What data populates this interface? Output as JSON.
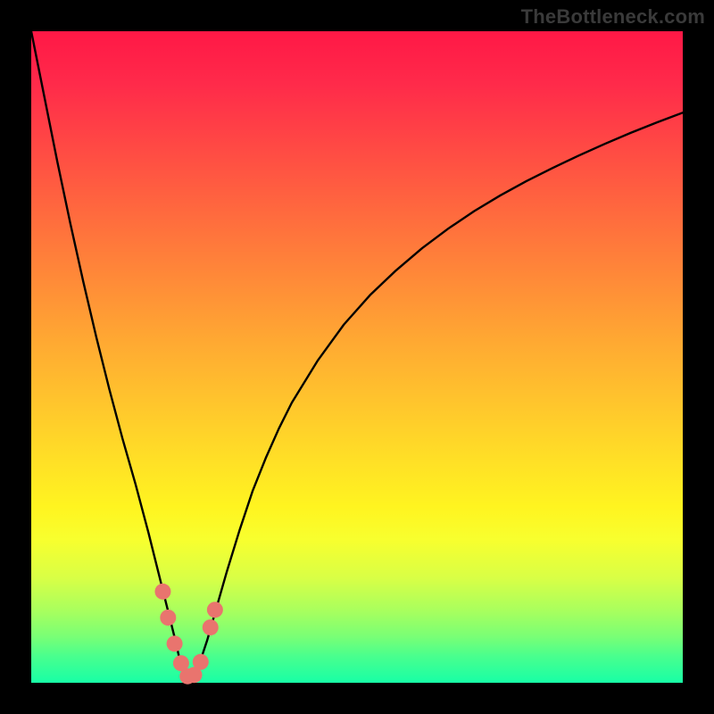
{
  "watermark": {
    "text": "TheBottleneck.com"
  },
  "chart_data": {
    "type": "line",
    "title": "",
    "xlabel": "",
    "ylabel": "",
    "xlim": [
      0,
      100
    ],
    "ylim": [
      0,
      100
    ],
    "series": [
      {
        "name": "bottleneck-curve",
        "x": [
          0,
          2,
          4,
          6,
          8,
          10,
          12,
          14,
          16,
          18,
          19,
          20,
          21,
          22,
          22.8,
          23.5,
          24.2,
          25,
          26,
          27,
          28,
          29,
          30,
          32,
          34,
          36,
          38,
          40,
          44,
          48,
          52,
          56,
          60,
          64,
          68,
          72,
          76,
          80,
          84,
          88,
          92,
          96,
          100
        ],
        "y": [
          100,
          90,
          80,
          70.5,
          61.5,
          53,
          45,
          37.5,
          30.5,
          23,
          19,
          15,
          11,
          7,
          3.5,
          1.5,
          0.5,
          1.2,
          3.5,
          6.5,
          10,
          13.5,
          17,
          23.5,
          29.5,
          34.5,
          39,
          43,
          49.5,
          55,
          59.5,
          63.3,
          66.7,
          69.7,
          72.4,
          74.8,
          77,
          79,
          80.9,
          82.7,
          84.4,
          86,
          87.5
        ]
      }
    ],
    "markers": {
      "name": "highlight-dots",
      "color": "#e9746e",
      "points": [
        {
          "x": 20.2,
          "y": 14
        },
        {
          "x": 21.0,
          "y": 10
        },
        {
          "x": 22.0,
          "y": 6
        },
        {
          "x": 23.0,
          "y": 3
        },
        {
          "x": 24.0,
          "y": 1
        },
        {
          "x": 25.0,
          "y": 1.2
        },
        {
          "x": 26.0,
          "y": 3.2
        },
        {
          "x": 27.5,
          "y": 8.5
        },
        {
          "x": 28.2,
          "y": 11.2
        }
      ]
    }
  }
}
